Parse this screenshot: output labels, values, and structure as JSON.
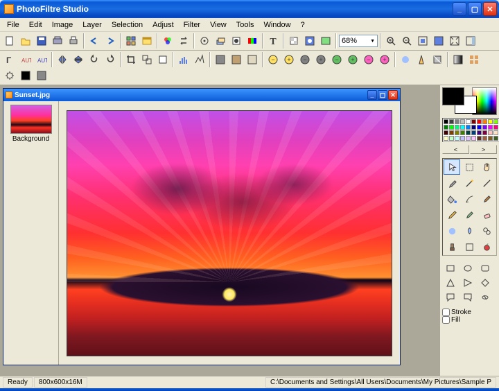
{
  "app": {
    "title": "PhotoFiltre Studio"
  },
  "menu": [
    "File",
    "Edit",
    "Image",
    "Layer",
    "Selection",
    "Adjust",
    "Filter",
    "View",
    "Tools",
    "Window",
    "?"
  ],
  "zoom": "68%",
  "doc": {
    "title": "Sunset.jpg",
    "layer": "Background"
  },
  "status": {
    "ready": "Ready",
    "dims": "800x600x16M",
    "path": "C:\\Documents and Settings\\All Users\\Documents\\My Pictures\\Sample P"
  },
  "palette_nav": {
    "prev": "<",
    "next": ">"
  },
  "opts": {
    "stroke": "Stroke",
    "fill": "Fill"
  },
  "toolbar1_icons": [
    "new",
    "open",
    "save",
    "twain",
    "printer",
    "sep",
    "undo",
    "redo",
    "sep",
    "image-manager",
    "explorer",
    "sep",
    "rgb",
    "swap",
    "sep",
    "options",
    "layers",
    "mask",
    "channels",
    "sep",
    "text",
    "sep",
    "transparent",
    "auto-transp",
    "export-gif",
    "sep",
    "zoom",
    "sep",
    "zoom-in",
    "zoom-out",
    "fit",
    "full",
    "fullscreen",
    "toggle-panel"
  ],
  "toolbar2_icons": [
    "text-left",
    "auto1",
    "auto2",
    "sep",
    "flip-h",
    "flip-v",
    "rot-ccw",
    "rot-cw",
    "sep",
    "crop",
    "resize",
    "canvas",
    "sep",
    "histogram",
    "levels",
    "sep",
    "grayscale",
    "sepia",
    "old",
    "sep",
    "bright-minus",
    "bright-plus",
    "contrast-minus",
    "contrast-plus",
    "gamma-minus",
    "gamma-plus",
    "sat-minus",
    "sat-plus",
    "sep",
    "blur",
    "sharpen",
    "relief",
    "sep",
    "grad",
    "tile",
    "prefs",
    "color-picker",
    "noise"
  ],
  "tools": [
    "pointer",
    "marquee",
    "hand",
    "eyedropper",
    "wand",
    "line",
    "bucket",
    "airbrush",
    "brush",
    "pencil",
    "adv-brush",
    "eraser",
    "blur",
    "smudge",
    "clone",
    "stamp",
    "shape",
    "apple"
  ],
  "shapes": [
    "rect",
    "ellipse",
    "rrect",
    "triangle",
    "triangle-r",
    "diamond",
    "speech-l",
    "speech-r",
    "custom"
  ],
  "palette_colors": [
    "#000000",
    "#404040",
    "#808080",
    "#c0c0c0",
    "#ffffff",
    "#800000",
    "#ff0000",
    "#ff8000",
    "#ffff00",
    "#80ff00",
    "#008000",
    "#00ff00",
    "#00ff80",
    "#00ffff",
    "#0080ff",
    "#000080",
    "#0000ff",
    "#8000ff",
    "#ff00ff",
    "#ff0080",
    "#400000",
    "#804000",
    "#808000",
    "#408000",
    "#004040",
    "#004080",
    "#400080",
    "#800040",
    "#ffc0c0",
    "#ffe0c0",
    "#ffffc0",
    "#c0ffc0",
    "#c0ffff",
    "#c0c0ff",
    "#e0c0ff",
    "#ffc0ff",
    "#603020",
    "#a06040",
    "#806020",
    "#406020"
  ]
}
